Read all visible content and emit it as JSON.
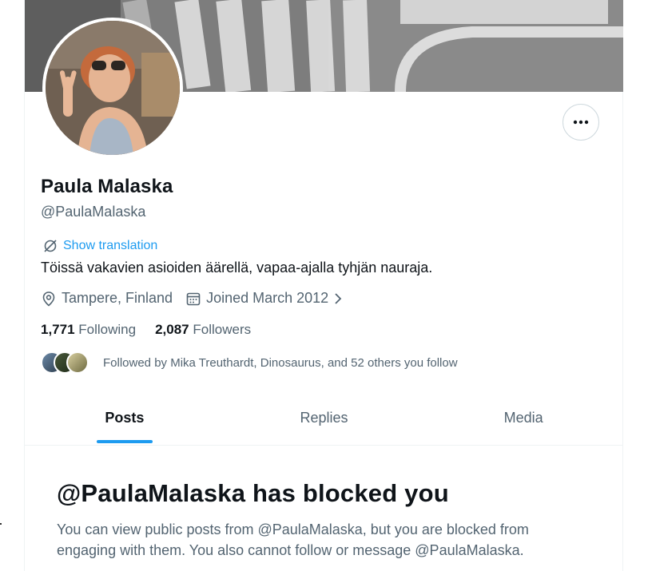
{
  "profile": {
    "name": "Paula Malaska",
    "handle": "@PaulaMalaska",
    "show_translation": "Show translation",
    "bio": "Töissä vakavien asioiden äärellä, vapaa-ajalla tyhjän nauraja.",
    "location": "Tampere, Finland",
    "joined": "Joined March 2012"
  },
  "stats": {
    "following_count": "1,771",
    "following_label": "Following",
    "followers_count": "2,087",
    "followers_label": "Followers"
  },
  "followed_by": "Followed by Mika Treuthardt, Dinosaurus, and 52 others you follow",
  "tabs": [
    {
      "label": "Posts",
      "active": true
    },
    {
      "label": "Replies",
      "active": false
    },
    {
      "label": "Media",
      "active": false
    }
  ],
  "blocked": {
    "title": "@PaulaMalaska has blocked you",
    "body": "You can view public posts from @PaulaMalaska, but you are blocked from engaging with them. You also cannot follow or message @PaulaMalaska."
  },
  "colors": {
    "accent": "#1d9bf0",
    "text_primary": "#0f1419",
    "text_secondary": "#536471",
    "border": "#eff3f4"
  },
  "icons": {
    "more": "more-horizontal-icon",
    "translate": "translate-icon",
    "location": "location-pin-icon",
    "calendar": "calendar-icon",
    "chevron": "chevron-right-icon"
  }
}
